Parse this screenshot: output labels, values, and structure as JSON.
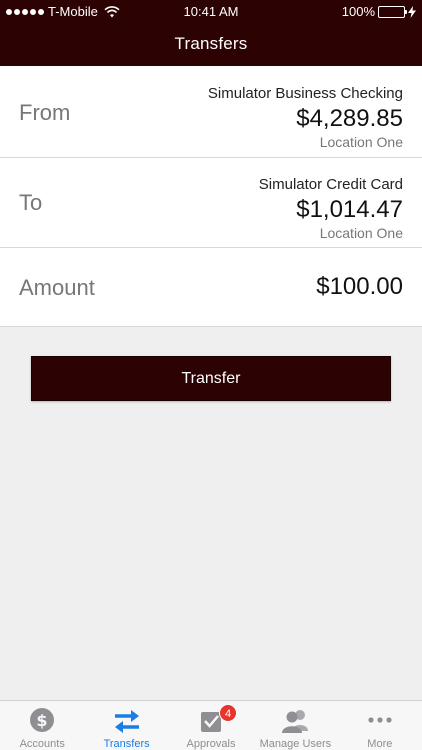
{
  "status_bar": {
    "carrier": "T-Mobile",
    "time": "10:41 AM",
    "battery": "100%"
  },
  "nav": {
    "title": "Transfers"
  },
  "from": {
    "label": "From",
    "account_name": "Simulator Business Checking",
    "balance": "$4,289.85",
    "location": "Location One"
  },
  "to": {
    "label": "To",
    "account_name": "Simulator Credit Card",
    "balance": "$1,014.47",
    "location": "Location One"
  },
  "amount": {
    "label": "Amount",
    "value": "$100.00"
  },
  "transfer_button": {
    "label": "Transfer"
  },
  "colors": {
    "brand": "#2c0203",
    "active_tab": "#1a7ee6",
    "inactive_tab": "#8e8e93",
    "badge": "#e8342a",
    "battery": "#4cd964"
  },
  "tabs": [
    {
      "label": "Accounts",
      "icon": "dollar-coin-icon"
    },
    {
      "label": "Transfers",
      "icon": "transfer-arrows-icon",
      "active": true
    },
    {
      "label": "Approvals",
      "icon": "checkbox-icon",
      "badge": "4"
    },
    {
      "label": "Manage Users",
      "icon": "users-icon"
    },
    {
      "label": "More",
      "icon": "more-dots-icon"
    }
  ]
}
